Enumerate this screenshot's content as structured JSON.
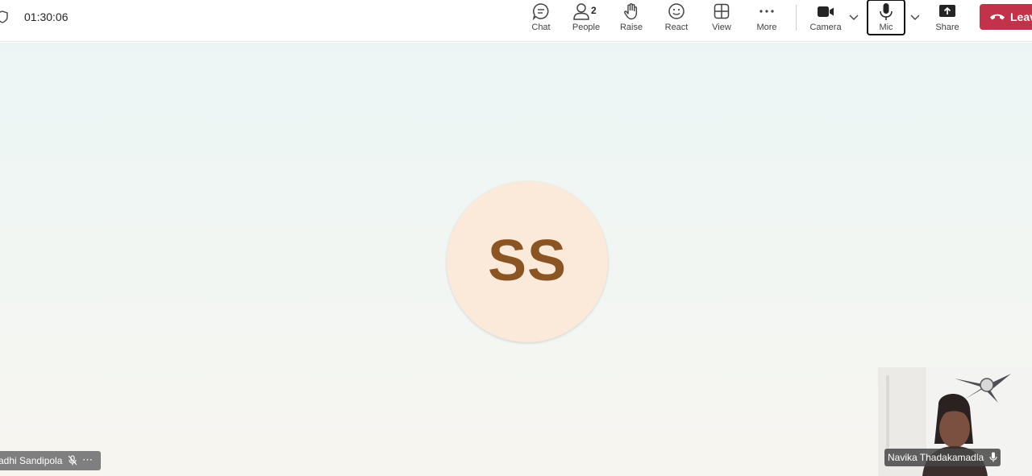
{
  "call": {
    "timer": "01:30:06"
  },
  "toolbar": {
    "chat_label": "Chat",
    "people_label": "People",
    "people_count": "2",
    "raise_label": "Raise",
    "react_label": "React",
    "view_label": "View",
    "more_label": "More",
    "camera_label": "Camera",
    "mic_label": "Mic",
    "share_label": "Share",
    "leave_label": "Leave"
  },
  "main_participant": {
    "initials": "SS",
    "name_visible": "adhi Sandipola",
    "muted": true,
    "avatar_bg": "#fbe9d9",
    "initials_color": "#8a5423"
  },
  "self_view": {
    "name": "Navika Thadakamadla"
  },
  "colors": {
    "leave": "#c4314b",
    "accent": "#424242"
  }
}
